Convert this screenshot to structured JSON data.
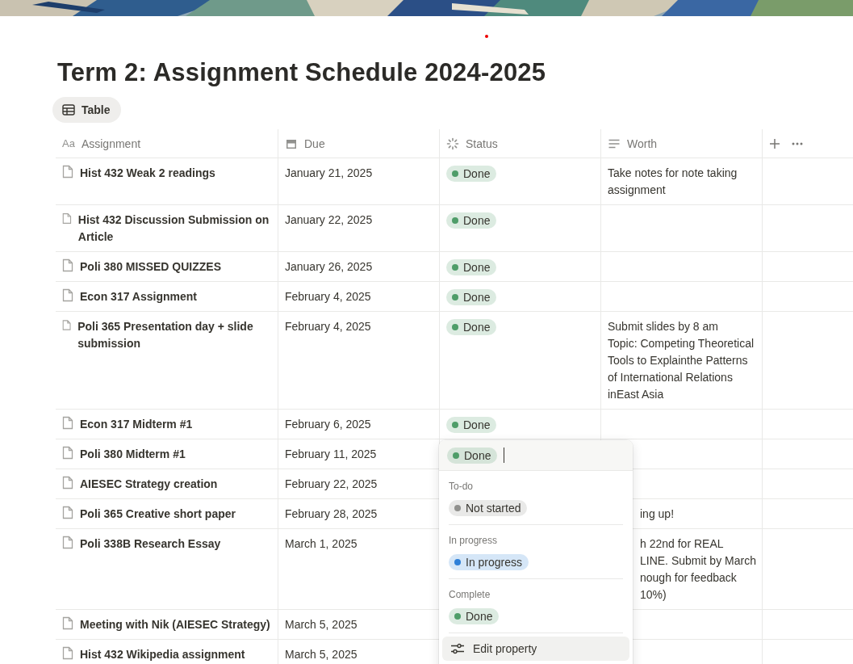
{
  "page": {
    "title": "Term 2: Assignment Schedule 2024-2025",
    "view_tab": {
      "label": "Table",
      "selected": true
    }
  },
  "table": {
    "columns": [
      {
        "label": "Assignment",
        "kind": "title",
        "icon_text": "Aa"
      },
      {
        "label": "Due",
        "kind": "date"
      },
      {
        "label": "Status",
        "kind": "status"
      },
      {
        "label": "Worth",
        "kind": "text"
      }
    ],
    "rows": [
      {
        "assignment": "Hist 432 Weak 2 readings",
        "due": "January 21, 2025",
        "status": {
          "label": "Done",
          "color": "#4f9d69"
        },
        "worth": "Take notes for note taking assignment"
      },
      {
        "assignment": "Hist 432 Discussion Submission on Article",
        "due": "January 22, 2025",
        "status": {
          "label": "Done",
          "color": "#4f9d69"
        }
      },
      {
        "assignment": "Poli 380 MISSED QUIZZES",
        "due": "January 26, 2025",
        "status": {
          "label": "Done",
          "color": "#4f9d69"
        }
      },
      {
        "assignment": "Econ 317 Assignment",
        "due": "February 4, 2025",
        "status": {
          "label": "Done",
          "color": "#4f9d69"
        }
      },
      {
        "assignment": "Poli 365 Presentation day + slide submission",
        "due": "February 4, 2025",
        "status": {
          "label": "Done",
          "color": "#4f9d69"
        },
        "worth": "Submit slides by 8 am\nTopic: Competing Theoretical Tools to Explainthe Patterns of International Relations inEast Asia"
      },
      {
        "assignment": "Econ 317 Midterm #1",
        "due": "February 6, 2025",
        "status": {
          "label": "Done",
          "color": "#4f9d69"
        }
      },
      {
        "assignment": "Poli 380 Midterm #1",
        "due": "February 11, 2025"
      },
      {
        "assignment": "AIESEC Strategy creation",
        "due": "February 22, 2025"
      },
      {
        "assignment": "Poli 365 Creative short paper",
        "due": "February 28, 2025",
        "worth": "ing up!",
        "covered": true
      },
      {
        "assignment": "Poli 338B Research Essay",
        "due": "March 1, 2025",
        "worth": "h 22nd for REAL\nLINE. Submit by March\nnough for feedback\n10%)",
        "covered": true
      },
      {
        "assignment": "Meeting with Nik (AIESEC Strategy)",
        "due": "March 5, 2025"
      },
      {
        "assignment": "Hist 432 Wikipedia assignment",
        "due": "March 5, 2025"
      }
    ]
  },
  "status_menu": {
    "current": {
      "label": "Done",
      "color": "#4f9d69"
    },
    "groups": [
      {
        "label": "To-do",
        "options": [
          {
            "label": "Not started",
            "color": "#91918e"
          }
        ]
      },
      {
        "label": "In progress",
        "options": [
          {
            "label": "In progress",
            "color": "#2f80d8"
          }
        ]
      },
      {
        "label": "Complete",
        "options": [
          {
            "label": "Done",
            "color": "#4f9d69"
          }
        ]
      }
    ],
    "footer": {
      "label": "Edit property",
      "hovered": true
    }
  }
}
